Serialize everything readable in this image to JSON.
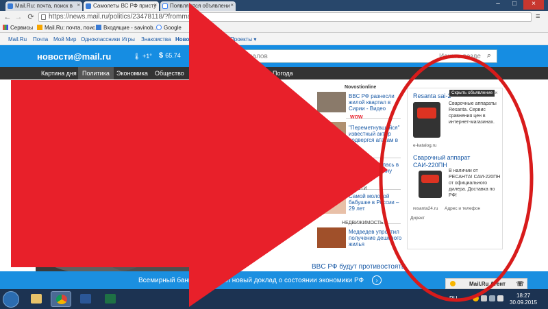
{
  "browser": {
    "tabs": [
      {
        "label": "Mail.Ru: почта, поиск в"
      },
      {
        "label": "Самолеты ВС РФ присту"
      },
      {
        "label": "Появляются объявлени"
      }
    ],
    "url": "https://news.mail.ru/politics/23478118/?frommail=",
    "bookmarks": [
      {
        "label": "Сервисы"
      },
      {
        "label": "Mail.Ru: почта, поис..."
      },
      {
        "label": "Входящие - savinob..."
      },
      {
        "label": "Google"
      }
    ]
  },
  "site": {
    "top_nav": [
      "Mail.Ru",
      "Почта",
      "Мой Мир",
      "Одноклассники",
      "Игры",
      "Знакомства",
      "Новости",
      "Покупки",
      "Проекты ▾"
    ],
    "logo": "новости@mail.ru",
    "weather": "+1°",
    "currency": "65.74",
    "search_placeholder": "материалов",
    "search_all": "Искать везде",
    "categories": [
      "Картина дня",
      "Политика",
      "Экономика",
      "Общество",
      "Погода"
    ],
    "news": [
      {
        "category": "Novostionline",
        "text": "BBC РФ разнесли жилой квартал в Сирии - Видео"
      },
      {
        "category": "WOW",
        "text": "\"Переметнувшийся\" известный актер подвергся атакам в"
      },
      {
        "category": "",
        "text": "Россия ввязалась в сирийскую войну"
      },
      {
        "category": "ДЕТИ",
        "text": "Самой молодой бабушке в России – 29 лет"
      },
      {
        "category": "НЕДВИЖИМОСТЬ",
        "text": "Медведев упростил получение дешевого жилья"
      }
    ],
    "ad": {
      "hide_label": "Скрыть объявление",
      "title1": "Resanta sai-2",
      "text1": "Сварочные аппараты Resanta. Сервис сравнения цен в интернет-магазинах.",
      "domain1": "e-katalog.ru",
      "title2": "Сварочный аппарат САИ-220ПН",
      "text2": "В наличии от РЕСАНТА! САИ-220ПН от официального дилера. Доставка по РФ!",
      "domain2": "resanta24.ru",
      "address": "Адрес и телефон",
      "footer": "Директ"
    },
    "bottom_headline": "BBC РФ будут противостоять",
    "banner_text": "Всемирный банк представил новый доклад о состоянии экономики РФ",
    "agent_label": "Mail.Ru Агент"
  },
  "taskbar": {
    "lang": "RU",
    "time": "18:27",
    "date": "30.09.2015"
  },
  "colors": {
    "accent": "#168de2",
    "arrow": "#e8202a",
    "circle": "#d81b1b"
  }
}
